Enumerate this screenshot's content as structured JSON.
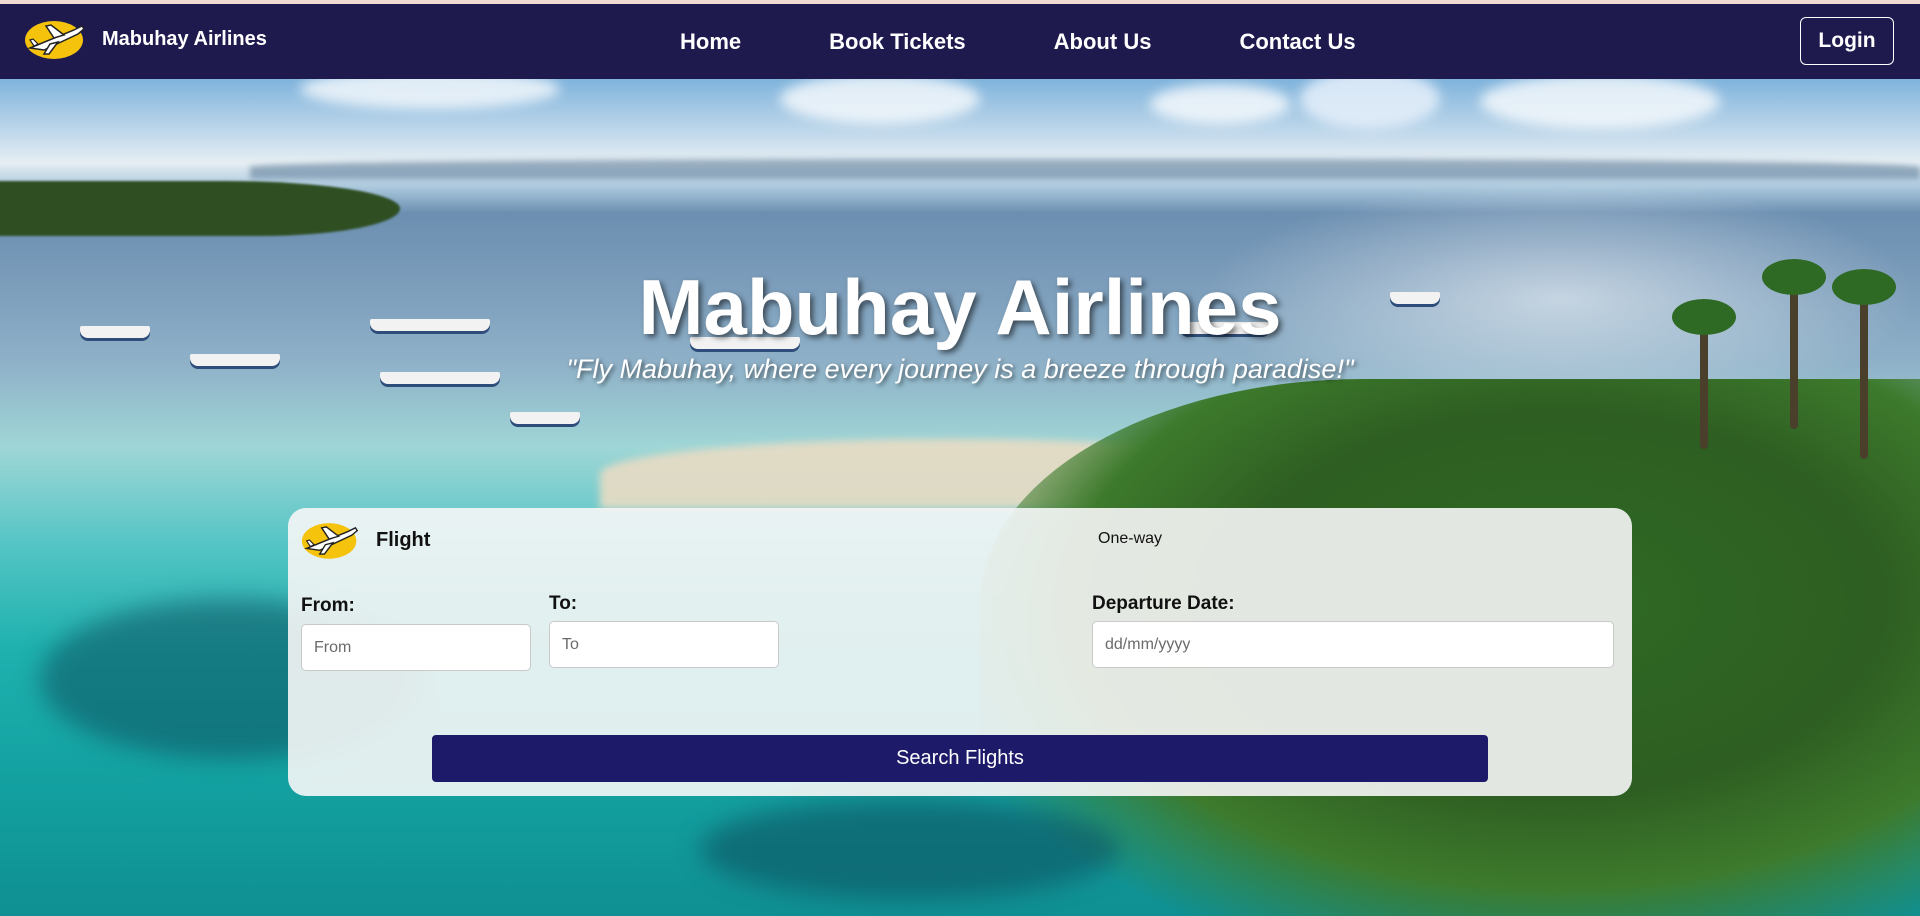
{
  "brand": {
    "name": "Mabuhay Airlines"
  },
  "nav": {
    "items": [
      {
        "label": "Home"
      },
      {
        "label": "Book Tickets"
      },
      {
        "label": "About Us"
      },
      {
        "label": "Contact Us"
      }
    ],
    "login_label": "Login"
  },
  "hero": {
    "title": "Mabuhay Airlines",
    "tagline": "\"Fly Mabuhay, where every journey is a breeze through paradise!\""
  },
  "booking": {
    "title": "Flight",
    "trip_type": "One-way",
    "from": {
      "label": "From:",
      "placeholder": "From",
      "value": ""
    },
    "to": {
      "label": "To:",
      "placeholder": "To",
      "value": ""
    },
    "departure": {
      "label": "Departure Date:",
      "placeholder": "dd/mm/yyyy",
      "value": ""
    },
    "search_label": "Search Flights"
  },
  "colors": {
    "nav_bg": "#1e1a4d",
    "accent": "#1e1a6a",
    "logo_yellow": "#f5c20c"
  },
  "icons": {
    "logo": "airplane-logo-icon"
  }
}
